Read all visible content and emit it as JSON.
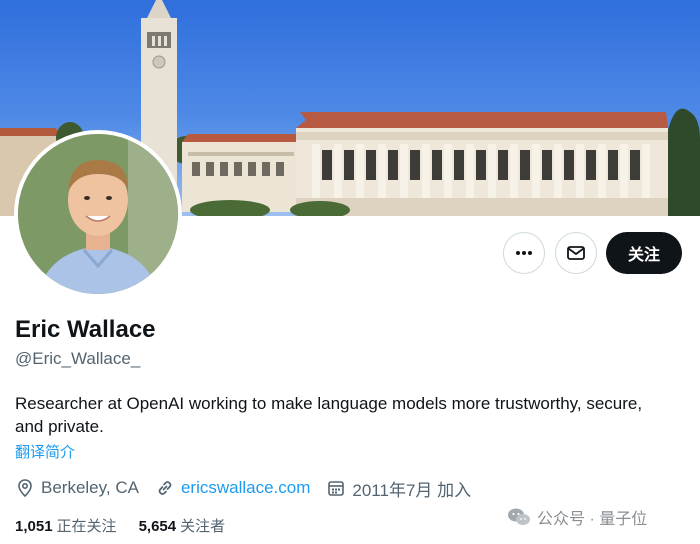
{
  "profile": {
    "name": "Eric Wallace",
    "handle": "@Eric_Wallace_",
    "bio": "Researcher at OpenAI working to make language models more trustworthy, secure, and private.",
    "translate_label": "翻译简介",
    "location": "Berkeley, CA",
    "website": "ericswallace.com",
    "joined": "2011年7月 加入",
    "following_count": "1,051",
    "following_label": "正在关注",
    "followers_count": "5,654",
    "followers_label": "关注者"
  },
  "actions": {
    "more_icon": "more-horizontal-icon",
    "message_icon": "envelope-icon",
    "follow_label": "关注"
  },
  "watermark": {
    "icon": "wechat-icon",
    "text": "公众号 · 量子位"
  },
  "colors": {
    "link": "#1d9bf0",
    "text_primary": "#0f1419",
    "text_secondary": "#536471",
    "follow_button_bg": "#0f1419"
  }
}
